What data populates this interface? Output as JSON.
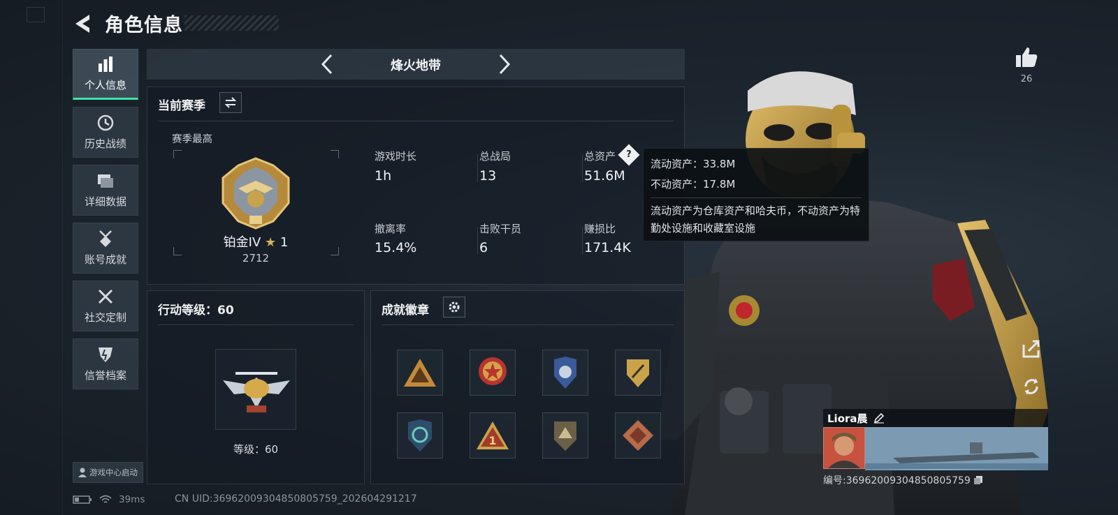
{
  "header": {
    "title": "角色信息"
  },
  "nav": {
    "items": [
      {
        "label": "个人信息",
        "icon": "bar-chart-icon",
        "active": true
      },
      {
        "label": "历史战绩",
        "icon": "clock-icon",
        "active": false
      },
      {
        "label": "详细数据",
        "icon": "folder-icon",
        "active": false
      },
      {
        "label": "账号成就",
        "icon": "medal-icon",
        "active": false
      },
      {
        "label": "社交定制",
        "icon": "tools-icon",
        "active": false
      },
      {
        "label": "信誉档案",
        "icon": "shield-bolt-icon",
        "active": false
      }
    ],
    "launch_label": "游戏中心启动"
  },
  "map_selector": {
    "name": "烽火地带"
  },
  "season": {
    "title": "当前赛季",
    "best_label": "赛季最高",
    "rank_name": "铂金IV",
    "rank_stars": "1",
    "rank_points": "2712",
    "stats": [
      {
        "label": "游戏时长",
        "value": "1h"
      },
      {
        "label": "总战局",
        "value": "13"
      },
      {
        "label": "总资产",
        "value": "51.6M"
      },
      {
        "label": "撤离率",
        "value": "15.4%"
      },
      {
        "label": "击败干员",
        "value": "6"
      },
      {
        "label": "赚损比",
        "value": "171.4K"
      }
    ],
    "help_symbol": "?"
  },
  "tooltip": {
    "liquid": "流动资产：33.8M",
    "fixed": "不动资产：17.8M",
    "description": "流动资产为仓库资产和哈夫币，不动资产为特勤处设施和收藏室设施"
  },
  "action_level": {
    "title": "行动等级：60",
    "level_label": "等级：60"
  },
  "badges": {
    "title": "成就徽章",
    "items": [
      "badge-triangle-soldiers",
      "badge-star-round",
      "badge-shield-blue",
      "badge-shield-gold",
      "badge-recycle-shield",
      "badge-triangle-one",
      "badge-shield-chevron",
      "badge-diamond-eagle"
    ]
  },
  "likes": {
    "count": "26"
  },
  "player": {
    "name": "Liora晨",
    "id": "编号:3696200930485080575​9"
  },
  "status": {
    "ping": "39ms",
    "uid": "CN UID:3696200930485080575​9_202604291217"
  },
  "colors": {
    "accent": "#3fe3a8",
    "gold": "#c9a34a"
  }
}
